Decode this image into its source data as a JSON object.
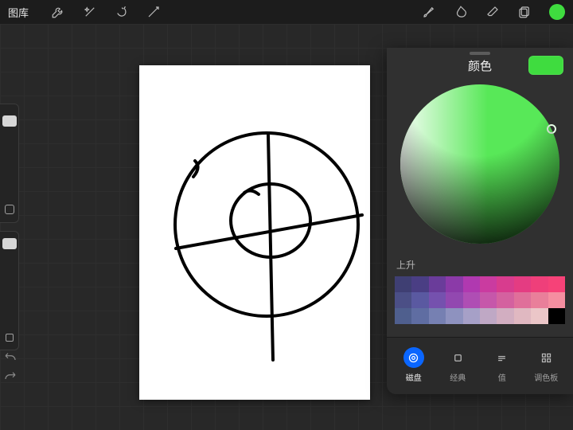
{
  "topbar": {
    "gallery_label": "图库",
    "current_color": "#3fdc3f"
  },
  "color_popup": {
    "title": "颜色",
    "section_label": "上升",
    "swatch": "#3fdc3f",
    "wheel_hue": "#58e858",
    "palette_rows": [
      [
        "#3f3f73",
        "#4a3e84",
        "#6a3c9a",
        "#8b3aa8",
        "#b039b0",
        "#ca3ba0",
        "#d83c8e",
        "#e43c82",
        "#ef3f7a",
        "#f64278"
      ],
      [
        "#4b4f86",
        "#5a59a1",
        "#7551ae",
        "#9248b0",
        "#af4eb4",
        "#c657aa",
        "#d4619f",
        "#e06f9a",
        "#e97f9a",
        "#f58ea0"
      ],
      [
        "#4f5f8e",
        "#5f6da2",
        "#7680b2",
        "#8e92bf",
        "#a6a0c7",
        "#bfa8c5",
        "#d2aec1",
        "#e0b8c1",
        "#ebc6c8",
        "#000000"
      ]
    ],
    "tabs": [
      {
        "id": "disc",
        "label": "磁盘",
        "active": true
      },
      {
        "id": "classic",
        "label": "经典",
        "active": false
      },
      {
        "id": "value",
        "label": "值",
        "active": false
      },
      {
        "id": "palette",
        "label": "调色板",
        "active": false
      }
    ]
  }
}
